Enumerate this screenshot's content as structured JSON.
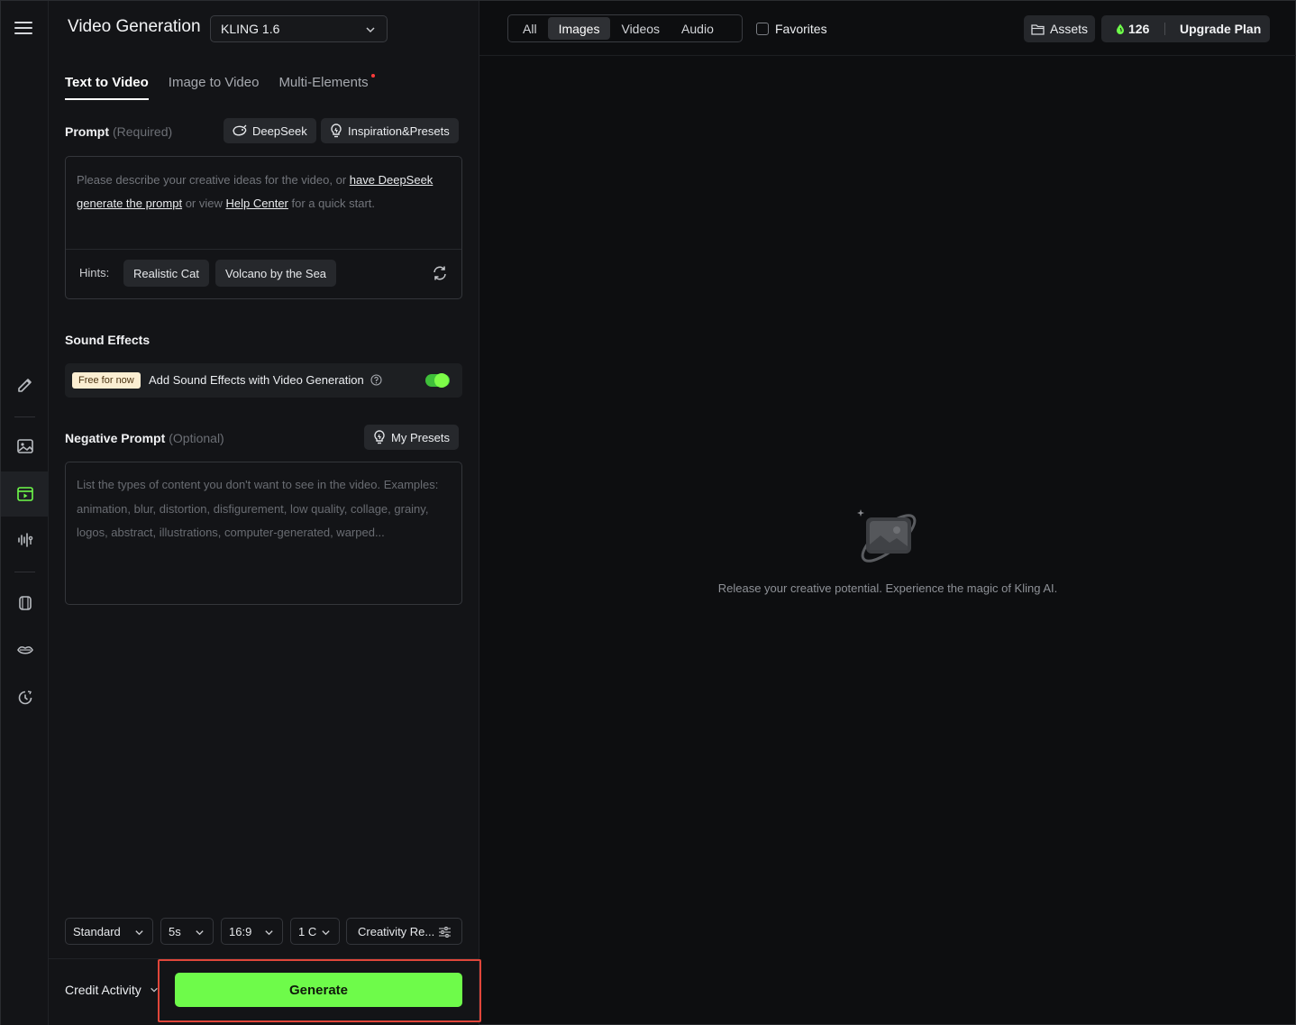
{
  "header": {
    "title": "Video Generation",
    "model": "KLING 1.6"
  },
  "tabs": [
    {
      "label": "Text to Video"
    },
    {
      "label": "Image to Video"
    },
    {
      "label": "Multi-Elements"
    }
  ],
  "prompt": {
    "label": "Prompt",
    "required": "(Required)",
    "deepseek_btn": "DeepSeek",
    "inspiration_btn": "Inspiration&Presets",
    "placeholder_1": "Please describe your creative ideas for the video, or",
    "link_1": "have DeepSeek generate the prompt",
    "placeholder_2": "or view",
    "link_2": "Help Center",
    "placeholder_3": "for a quick start.",
    "hints_label": "Hints:",
    "hints": [
      "Realistic Cat",
      "Volcano by the Sea"
    ]
  },
  "sound": {
    "heading": "Sound Effects",
    "badge": "Free for now",
    "label": "Add Sound Effects with Video Generation",
    "enabled": true
  },
  "negative": {
    "label": "Negative Prompt",
    "optional": "(Optional)",
    "presets_btn": "My Presets",
    "placeholder": "List the types of content you don't want to see in the video. Examples: animation, blur, distortion, disfigurement, low quality, collage, grainy, logos, abstract, illustrations, computer-generated, warped..."
  },
  "options": {
    "mode": "Standard",
    "duration": "5s",
    "ratio": "16:9",
    "count": "1 C",
    "creativity": "Creativity Re..."
  },
  "footer": {
    "credit_activity": "Credit Activity",
    "generate": "Generate"
  },
  "topbar": {
    "filters": [
      "All",
      "Images",
      "Videos",
      "Audio"
    ],
    "active_filter": "Images",
    "favorites": "Favorites",
    "assets": "Assets",
    "credits": "126",
    "upgrade": "Upgrade Plan"
  },
  "empty_state": {
    "message": "Release your creative potential. Experience the magic of Kling AI."
  },
  "colors": {
    "accent": "#6efb4a",
    "highlight": "#e0463a",
    "background": "#0d0e10",
    "panel": "#131417"
  }
}
